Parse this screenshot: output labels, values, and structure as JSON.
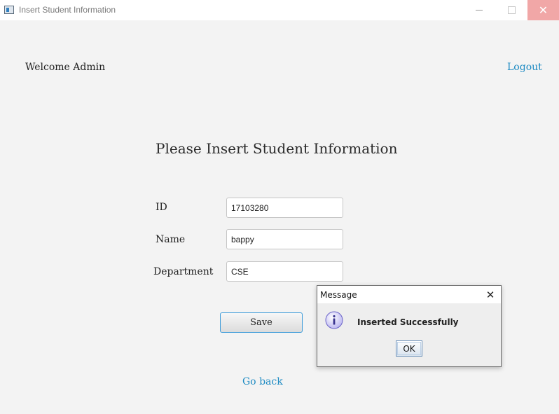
{
  "window": {
    "title": "Insert Student Information",
    "close_glyph": "✕"
  },
  "header": {
    "welcome": "Welcome  Admin",
    "logout": "Logout"
  },
  "form": {
    "title": "Please Insert Student Information",
    "fields": [
      {
        "label": "ID",
        "value": "17103280"
      },
      {
        "label": "Name",
        "value": "bappy"
      },
      {
        "label": "Department",
        "value": "CSE"
      }
    ],
    "save_label": "Save",
    "go_back_label": "Go back"
  },
  "dialog": {
    "title": "Message",
    "close_glyph": "✕",
    "icon": "info-icon",
    "message": "Inserted Successfully",
    "ok_label": "OK"
  },
  "colors": {
    "link": "#1e8bc3",
    "background": "#f3f3f3",
    "close_button": "#f1a7a7"
  }
}
